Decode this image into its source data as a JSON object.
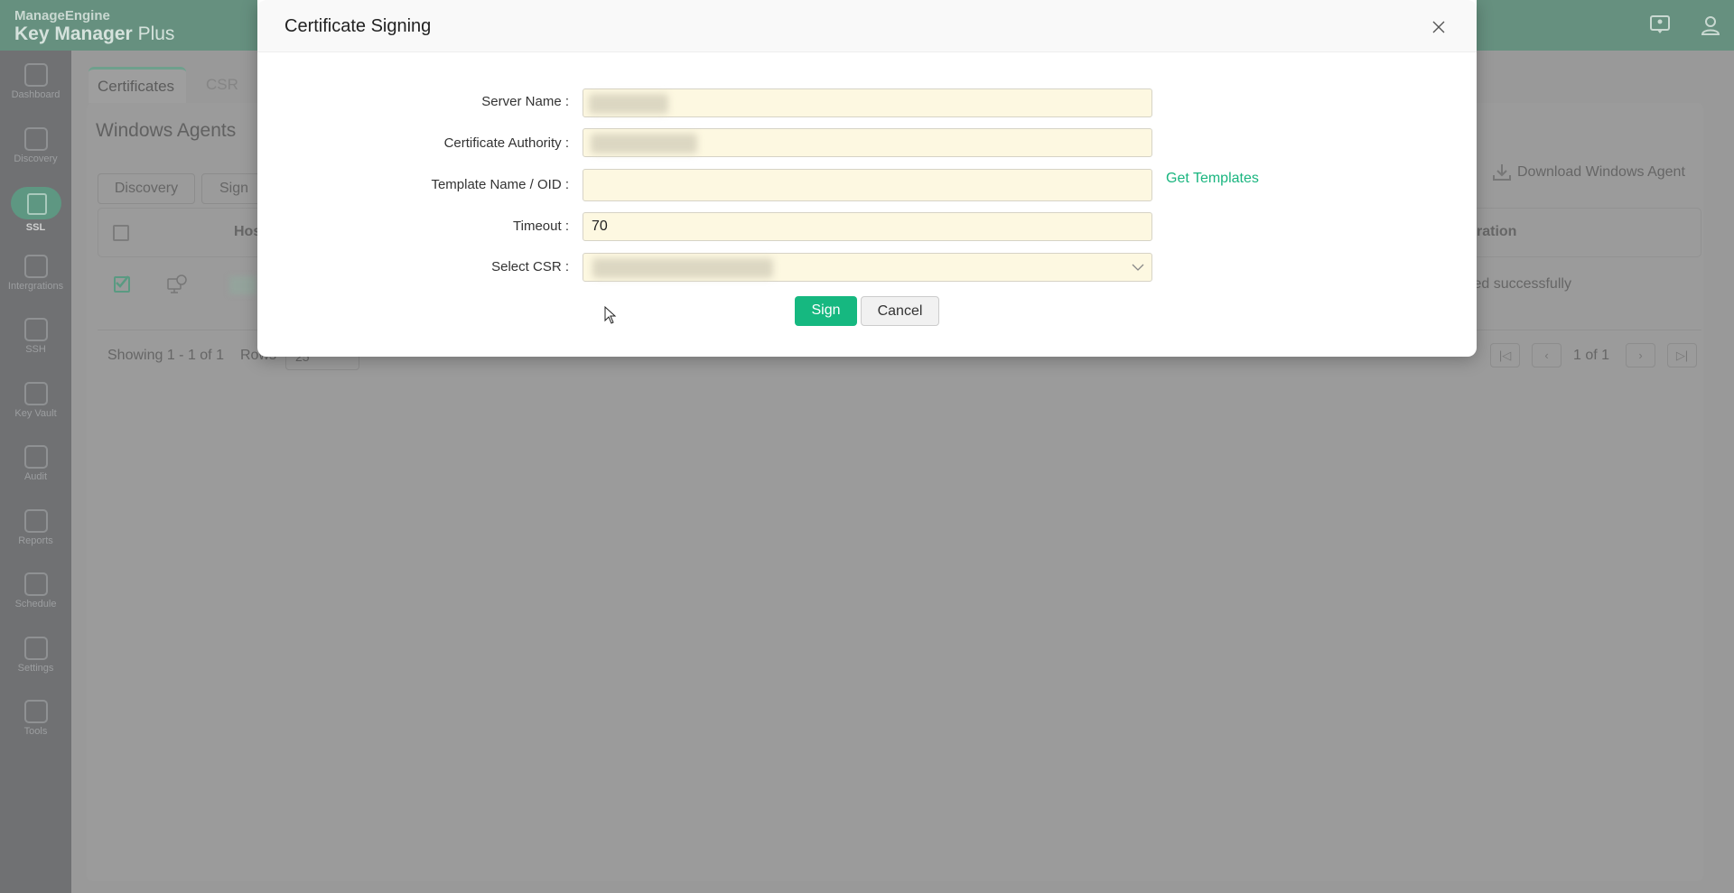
{
  "header": {
    "brand_top": "ManageEngine",
    "brand_name": "Key Manager",
    "brand_suffix": "Plus",
    "icons": [
      "support-chat-icon",
      "user-profile-icon"
    ]
  },
  "sidebar": {
    "items": [
      {
        "label": "Dashboard",
        "icon": "dashboard-icon"
      },
      {
        "label": "Discovery",
        "icon": "compass-icon"
      },
      {
        "label": "SSL",
        "icon": "certificate-icon",
        "active": true
      },
      {
        "label": "Intergrations",
        "icon": "plug-icon"
      },
      {
        "label": "SSH",
        "icon": "ssh-terminal-icon"
      },
      {
        "label": "Key Vault",
        "icon": "vault-icon"
      },
      {
        "label": "Audit",
        "icon": "audit-icon"
      },
      {
        "label": "Reports",
        "icon": "reports-icon"
      },
      {
        "label": "Schedule",
        "icon": "calendar-icon"
      },
      {
        "label": "Settings",
        "icon": "gear-icon"
      },
      {
        "label": "Tools",
        "icon": "tools-icon"
      }
    ]
  },
  "tabs": [
    {
      "label": "Certificates",
      "active": true
    },
    {
      "label": "CSR"
    }
  ],
  "main": {
    "title": "Windows Agents",
    "buttons": {
      "discovery": "Discovery",
      "sign": "Sign"
    },
    "download_label": "Download Windows Agent",
    "table": {
      "header_left": "Hos",
      "header_right": "ration",
      "row_status": "ted successfully"
    },
    "pagination": {
      "showing": "Showing 1 - 1 of 1",
      "rows_label": "Rows",
      "rows_value": "25",
      "page": "1 of 1"
    }
  },
  "dialog": {
    "title": "Certificate Signing",
    "fields": [
      {
        "label": "Server Name :",
        "value": ""
      },
      {
        "label": "Certificate Authority :",
        "value": ""
      },
      {
        "label": "Template Name / OID :",
        "value": ""
      },
      {
        "label": "Timeout :",
        "value": "70"
      },
      {
        "label": "Select CSR :",
        "value": ""
      }
    ],
    "get_templates": "Get Templates",
    "sign": "Sign",
    "cancel": "Cancel"
  },
  "colors": {
    "accent": "#16b880",
    "input_bg": "#fdf8e1"
  }
}
